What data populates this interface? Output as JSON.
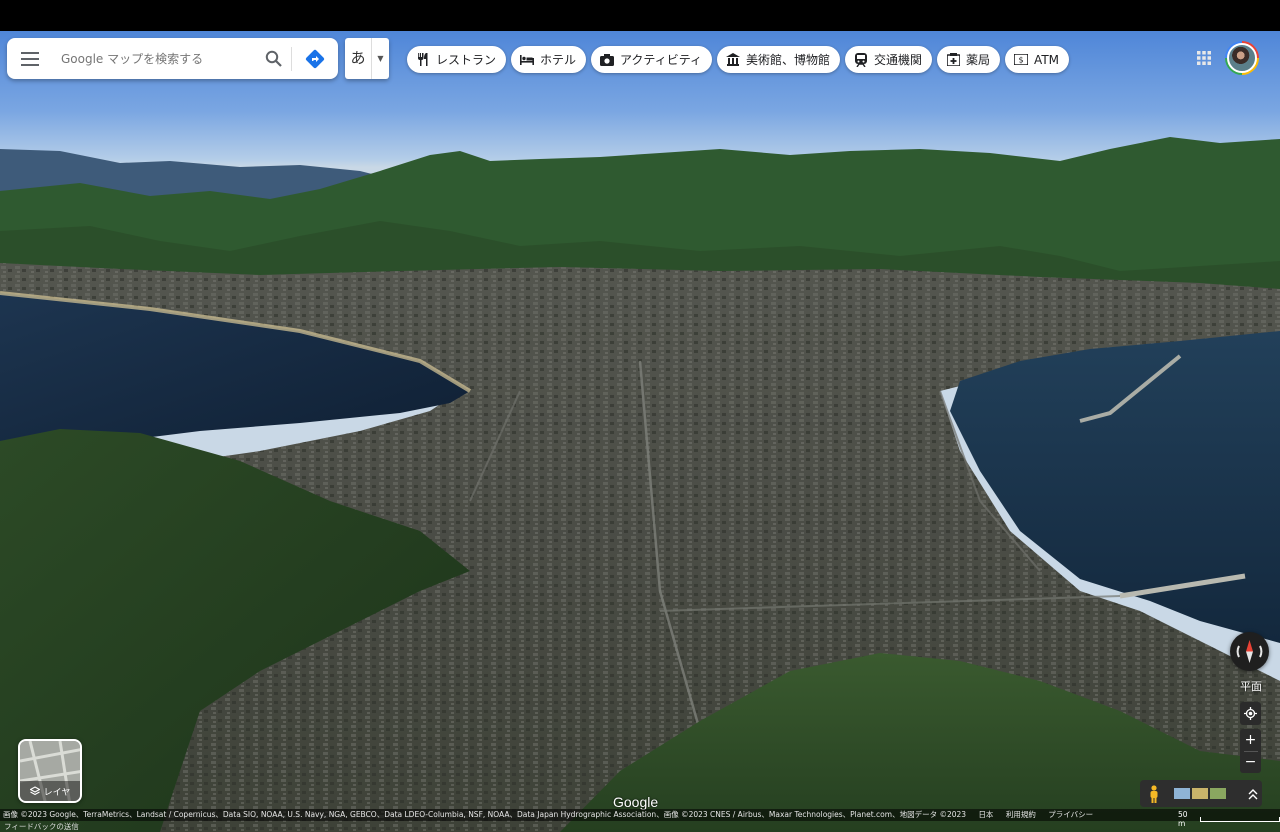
{
  "search": {
    "placeholder": "Google マップを検索する"
  },
  "ime": {
    "char": "あ"
  },
  "chips": [
    {
      "label": "レストラン",
      "icon": "restaurant-icon"
    },
    {
      "label": "ホテル",
      "icon": "hotel-icon"
    },
    {
      "label": "アクティビティ",
      "icon": "camera-icon"
    },
    {
      "label": "美術館、博物館",
      "icon": "museum-icon"
    },
    {
      "label": "交通機関",
      "icon": "train-icon"
    },
    {
      "label": "薬局",
      "icon": "pharmacy-icon"
    },
    {
      "label": "ATM",
      "icon": "atm-icon"
    }
  ],
  "layers": {
    "label": "レイヤ"
  },
  "controls": {
    "flat_label": "平面",
    "zoom_in": "+",
    "zoom_out": "−"
  },
  "logo": "Google",
  "attribution": {
    "imagery": "画像 ©2023 Google、TerraMetrics、Landsat / Copernicus、Data SIO, NOAA, U.S. Navy, NGA, GEBCO、Data LDEO-Columbia, NSF, NOAA、Data Japan Hydrographic Association、画像 ©2023 CNES / Airbus、Maxar Technologies、Planet.com、地図データ ©2023",
    "region": "日本",
    "terms": "利用規約",
    "privacy": "プライバシー",
    "scale": "50 m",
    "feedback": "フィードバックの送信"
  },
  "colors": {
    "accent": "#1a73e8",
    "chip_bg": "#ffffff",
    "sea": "#17304a",
    "forest": "#2e4a2a"
  }
}
